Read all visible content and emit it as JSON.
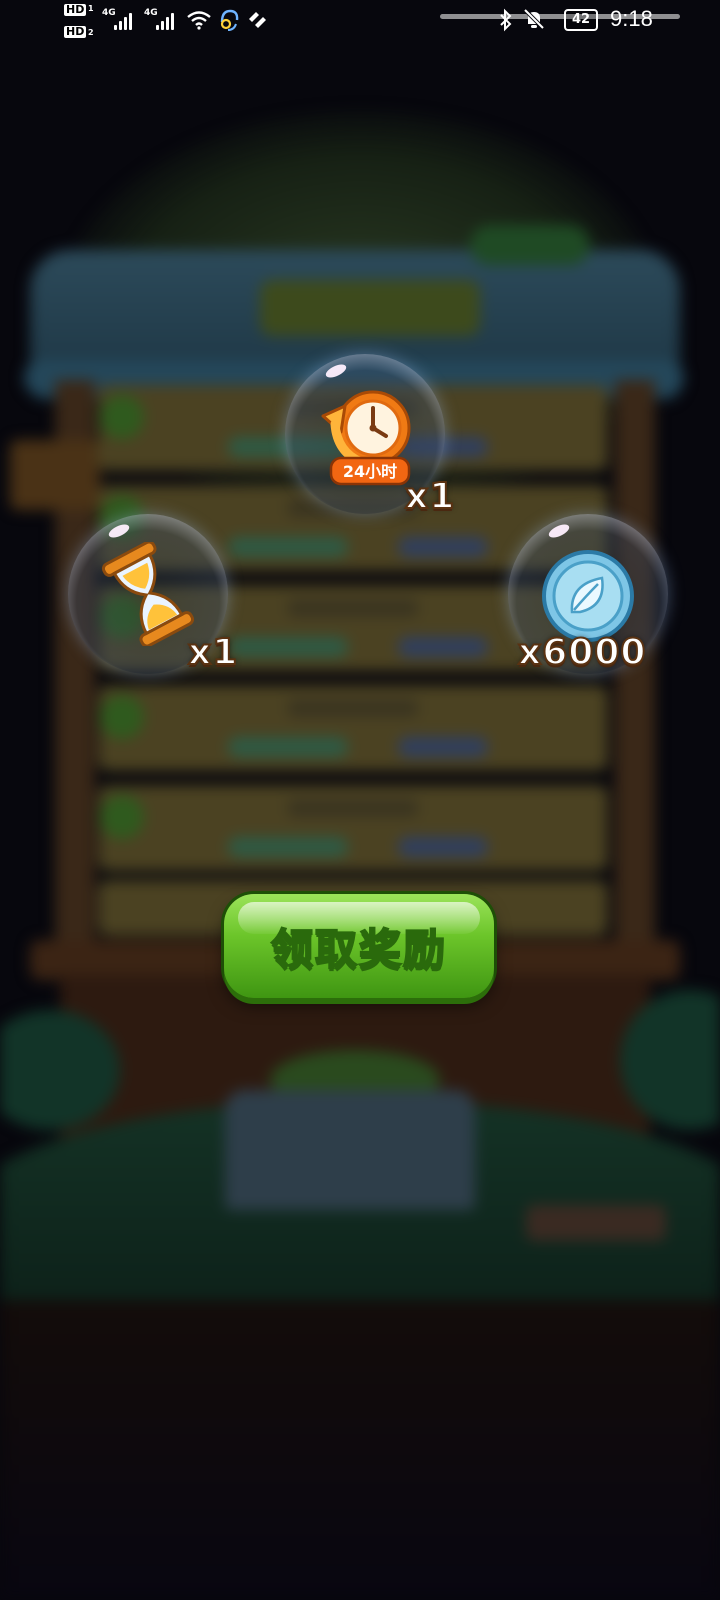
{
  "status_bar": {
    "sim1_badge": "HD",
    "sim1_index": "1",
    "sim2_badge": "HD",
    "sim2_index": "2",
    "network1": "4G",
    "network2": "4G",
    "icons": [
      "wifi-icon",
      "headset-icon",
      "app-icon",
      "bluetooth-icon",
      "mute-icon"
    ],
    "battery": "42",
    "time": "9:18"
  },
  "rewards": [
    {
      "item": "time-boost-clock-icon",
      "badge": "24小时",
      "quantity": "x1"
    },
    {
      "item": "hourglass-icon",
      "quantity": "x1"
    },
    {
      "item": "leaf-coin-icon",
      "quantity": "x6000"
    }
  ],
  "claim_button": {
    "label": "领取奖励"
  },
  "colors": {
    "button_green": "#6cc52a",
    "overlay_dark": "#07070d",
    "qty_outline": "#5a3212"
  }
}
